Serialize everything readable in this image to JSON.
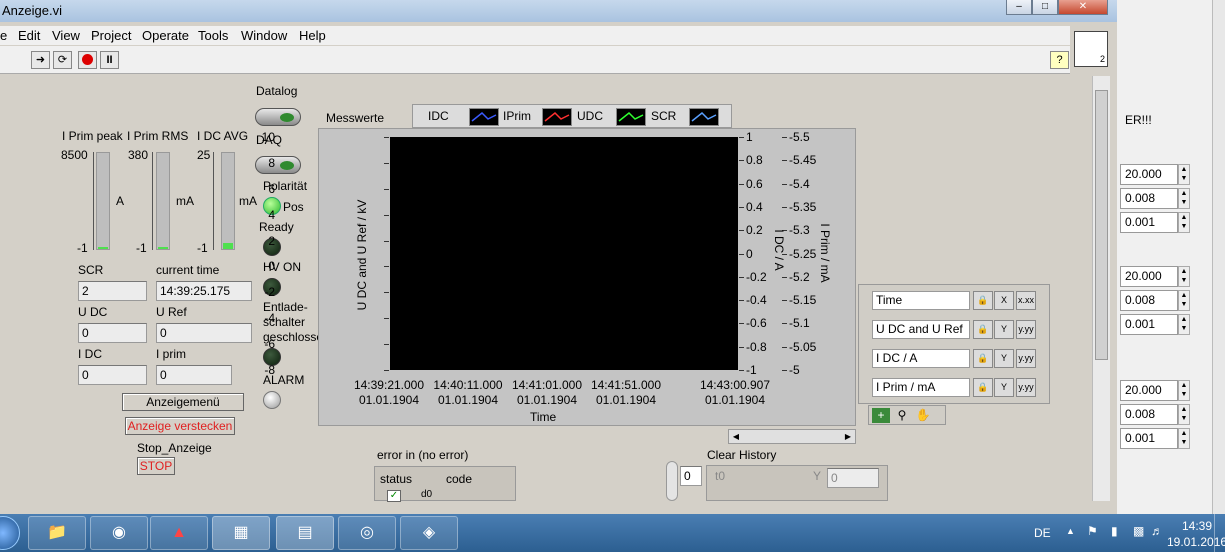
{
  "window": {
    "title": "Anzeige.vi"
  },
  "menu": [
    "Edit",
    "View",
    "Project",
    "Operate",
    "Tools",
    "Window",
    "Help"
  ],
  "panel": {
    "datalog_label": "Datalog",
    "daq_label": "DAQ",
    "polaritaet_label": "Polarität",
    "pos_label": "Pos",
    "ready_label": "Ready",
    "hv_on_label": "HV ON",
    "entlade_line1": "Entlade-",
    "entlade_line2": "schalter",
    "entlade_line3": "geschlosse",
    "alarm_label": "ALARM",
    "tanks": [
      {
        "label": "I Prim peak",
        "max": "8500",
        "min": "-1",
        "unit": "A",
        "fill": 0.02
      },
      {
        "label": "I Prim RMS",
        "max": "380",
        "min": "-1",
        "unit": "mA",
        "fill": 0.02
      },
      {
        "label": "I DC AVG",
        "max": "25",
        "min": "-1",
        "unit": "mA",
        "fill": 0.06
      }
    ],
    "scr_label": "SCR",
    "scr_value": "2",
    "current_time_label": "current time",
    "current_time_value": "14:39:25.175",
    "udc_label": "U DC",
    "udc_value": "0",
    "uref_label": "U Ref",
    "uref_value": "0",
    "idc_label": "I DC",
    "idc_value": "0",
    "iprim_label": "I prim",
    "iprim_value": "0",
    "anzeigemenu_button": "Anzeigemenü",
    "anzeige_verstecken_button": "Anzeige verstecken",
    "stop_anzeige_label": "Stop_Anzeige",
    "stop_button": "STOP",
    "error_in_label": "error in (no error)",
    "status_label": "status",
    "code_label": "code",
    "code_value": "d0",
    "clear_history_label": "Clear History",
    "clear_t0_label": "t0",
    "clear_y_label": "Y",
    "clear_y_value": "0",
    "numeric_value": "0",
    "right_cut_text": "ER!!!",
    "right_values": [
      "20.000",
      "0.008",
      "0.001",
      "20.000",
      "0.008",
      "0.001",
      "20.000",
      "0.008",
      "0.001"
    ]
  },
  "chart_data": {
    "type": "line",
    "title": "Messwerte",
    "xlabel": "Time",
    "ylabel": "U DC and U Ref / kV",
    "y2label": "I DC / A",
    "y3label": "I Prim / mA",
    "legend": [
      "IDC",
      "IPrim",
      "UDC",
      "SCR"
    ],
    "legend_colors": [
      "#3b5bff",
      "#ff3030",
      "#30ff30",
      "#5aa0ff"
    ],
    "ylim": [
      -8,
      10
    ],
    "y_ticks": [
      "10",
      "8",
      "6",
      "4",
      "2",
      "0",
      "-2",
      "-4",
      "-6",
      "-8"
    ],
    "y2lim": [
      -1,
      1
    ],
    "y2_ticks": [
      "1",
      "0.8",
      "0.6",
      "0.4",
      "0.2",
      "0",
      "-0.2",
      "-0.4",
      "-0.6",
      "-0.8",
      "-1"
    ],
    "y3lim": [
      -5.5,
      -5
    ],
    "y3_ticks": [
      "-5.5",
      "-5.45",
      "-5.4",
      "-5.35",
      "-5.3",
      "-5.25",
      "-5.2",
      "-5.15",
      "-5.1",
      "-5.05",
      "-5"
    ],
    "x_ticks": [
      {
        "time": "14:39:21.000",
        "date": "01.01.1904"
      },
      {
        "time": "14:40:11.000",
        "date": "01.01.1904"
      },
      {
        "time": "14:41:01.000",
        "date": "01.01.1904"
      },
      {
        "time": "14:41:51.000",
        "date": "01.01.1904"
      },
      {
        "time": "14:43:00.907",
        "date": "01.01.1904"
      }
    ],
    "series": []
  },
  "scale_legend": [
    "Time",
    "U DC and U Ref",
    "I DC / A",
    "I Prim / mA"
  ],
  "taskbar": {
    "lang": "DE",
    "time": "14:39",
    "date": "19.01.2016"
  }
}
